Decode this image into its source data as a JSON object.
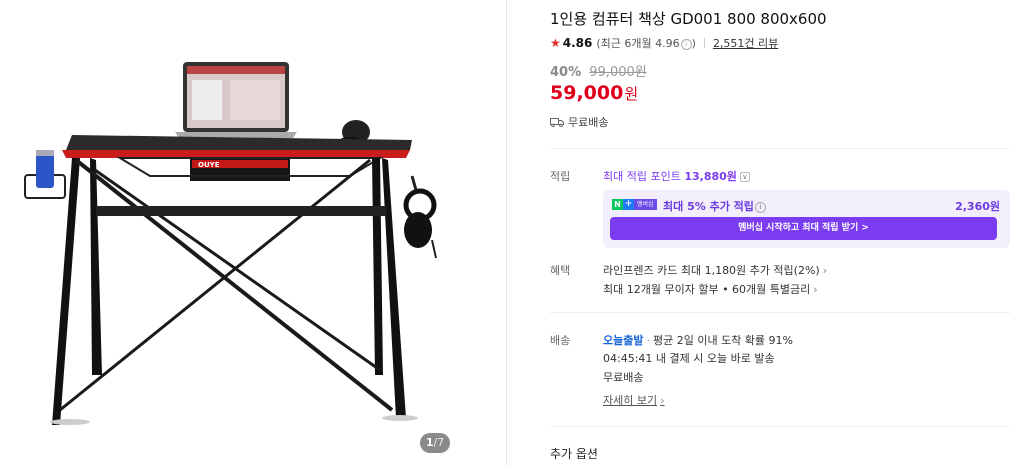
{
  "gallery": {
    "counter_current": "1",
    "counter_total": "/7",
    "product_brand": "OUYE"
  },
  "product": {
    "title": "1인용 컴퓨터 책상 GD001 800 800x600"
  },
  "rating": {
    "score": "4.86",
    "recent": "(최근 6개월 4.96",
    "recent_close": ")",
    "reviews": "2,551건 리뷰"
  },
  "price": {
    "discount": "40%",
    "original": "99,000원",
    "sale": "59,000",
    "unit": "원"
  },
  "shipping": {
    "label": "무료배송"
  },
  "points": {
    "row_label": "적립",
    "max_label": "최대 적립 포인트",
    "max_value": "13,880원",
    "np_n": "N",
    "np_plus": "+",
    "np_member": "멤버십",
    "extra_label": "최대 5% 추가 적립",
    "extra_value": "2,360원",
    "member_button": "멤버십 시작하고 최대 적립 받기 >"
  },
  "benefit": {
    "row_label": "혜택",
    "line1": "라인프렌즈 카드 최대 1,180원 추가 적립(2%)",
    "line2": "최대 12개월 무이자 할부 • 60개월 특별금리"
  },
  "delivery": {
    "row_label": "배송",
    "tag": "오늘출발",
    "dot": "·",
    "info": "평균 2일 이내 도착 확률 91%",
    "deadline": "04:45:41  내 결제 시 오늘 바로 발송",
    "free": "무료배송",
    "detail": "자세히 보기"
  },
  "options": {
    "label": "추가 옵션"
  },
  "colors": {
    "sale": "#e0001c",
    "accent": "#7b3cf0",
    "today": "#1a66d9"
  }
}
